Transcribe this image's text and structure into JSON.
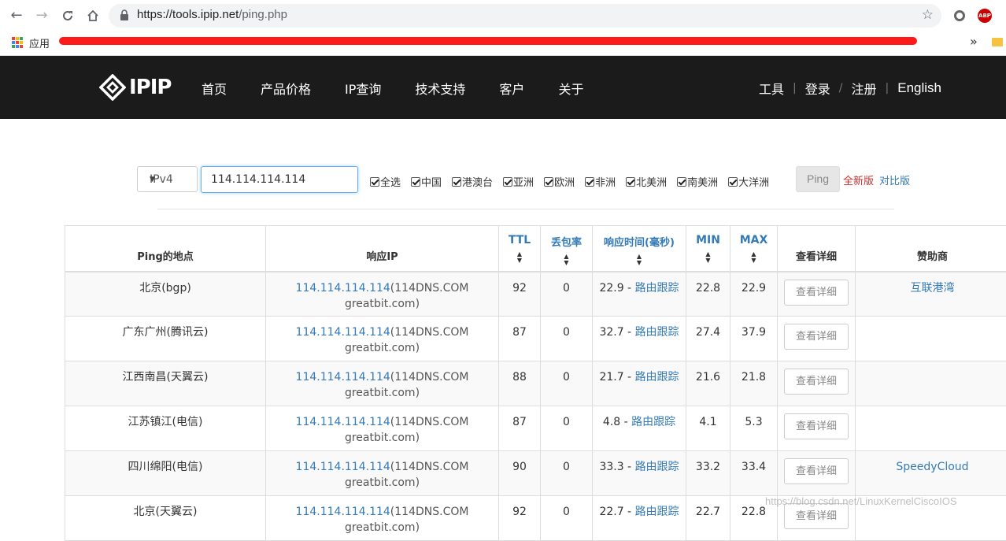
{
  "browser": {
    "url_host": "https://tools.ipip.net",
    "url_path": "/ping.php",
    "bookmarks_label": "应用",
    "more_label": "»"
  },
  "header": {
    "logo_text": "IPIP",
    "nav": [
      "首页",
      "产品价格",
      "IP查询",
      "技术支持",
      "客户",
      "关于"
    ],
    "right_nav": [
      "工具",
      "登录",
      "注册",
      "English"
    ]
  },
  "form": {
    "ip_version": "IPv4",
    "ip_value": "114.114.114.114",
    "checkboxes": [
      "全选",
      "中国",
      "港澳台",
      "亚洲",
      "欧洲",
      "非洲",
      "北美洲",
      "南美洲",
      "大洋洲"
    ],
    "ping_label": "Ping",
    "new_version_label": "全新版",
    "compare_label": "对比版"
  },
  "table": {
    "headers": {
      "location": "Ping的地点",
      "response_ip": "响应IP",
      "ttl": "TTL",
      "loss": "丢包率",
      "resp_time": "响应时间(毫秒)",
      "min": "MIN",
      "max": "MAX",
      "detail": "查看详细",
      "sponsor": "赞助商"
    },
    "route_label": "路由跟踪",
    "detail_label": "查看详细",
    "rows": [
      {
        "location": "北京(bgp)",
        "ip": "114.114.114.114",
        "host_a": "(114DNS.COM",
        "host_b": "greatbit.com)",
        "ttl": "92",
        "loss": "0",
        "time": "22.9",
        "min": "22.8",
        "max": "22.9",
        "sponsor": "互联港湾"
      },
      {
        "location": "广东广州(腾讯云)",
        "ip": "114.114.114.114",
        "host_a": "(114DNS.COM",
        "host_b": "greatbit.com)",
        "ttl": "87",
        "loss": "0",
        "time": "32.7",
        "min": "27.4",
        "max": "37.9",
        "sponsor": ""
      },
      {
        "location": "江西南昌(天翼云)",
        "ip": "114.114.114.114",
        "host_a": "(114DNS.COM",
        "host_b": "greatbit.com)",
        "ttl": "88",
        "loss": "0",
        "time": "21.7",
        "min": "21.6",
        "max": "21.8",
        "sponsor": ""
      },
      {
        "location": "江苏镇江(电信)",
        "ip": "114.114.114.114",
        "host_a": "(114DNS.COM",
        "host_b": "greatbit.com)",
        "ttl": "87",
        "loss": "0",
        "time": "4.8",
        "min": "4.1",
        "max": "5.3",
        "sponsor": ""
      },
      {
        "location": "四川绵阳(电信)",
        "ip": "114.114.114.114",
        "host_a": "(114DNS.COM",
        "host_b": "greatbit.com)",
        "ttl": "90",
        "loss": "0",
        "time": "33.3",
        "min": "33.2",
        "max": "33.4",
        "sponsor": "SpeedyCloud"
      },
      {
        "location": "北京(天翼云)",
        "ip": "114.114.114.114",
        "host_a": "(114DNS.COM",
        "host_b": "greatbit.com)",
        "ttl": "92",
        "loss": "0",
        "time": "22.7",
        "min": "22.7",
        "max": "22.8",
        "sponsor": ""
      }
    ]
  },
  "watermark": "https://blog.csdn.net/LinuxKernelCiscoIOS"
}
